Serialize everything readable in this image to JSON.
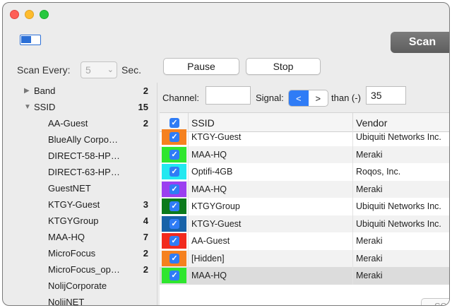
{
  "toolbar": {
    "scan_label": "Scan",
    "scan_every_label": "Scan Every:",
    "interval_value": "5",
    "sec_label": "Sec.",
    "pause_label": "Pause",
    "stop_label": "Stop"
  },
  "filters": {
    "channel_label": "Channel:",
    "channel_value": "",
    "signal_label": "Signal:",
    "signal_less": "<",
    "signal_greater": ">",
    "than_label": "than (-)",
    "threshold_value": "35"
  },
  "tree": [
    {
      "label": "Band",
      "count": "2",
      "expanded": false,
      "level": 0
    },
    {
      "label": "SSID",
      "count": "15",
      "expanded": true,
      "level": 0
    },
    {
      "label": "AA-Guest",
      "count": "2",
      "level": 1
    },
    {
      "label": "BlueAlly Corpo…",
      "count": "",
      "level": 1
    },
    {
      "label": "DIRECT-58-HP…",
      "count": "",
      "level": 1
    },
    {
      "label": "DIRECT-63-HP…",
      "count": "",
      "level": 1
    },
    {
      "label": "GuestNET",
      "count": "",
      "level": 1
    },
    {
      "label": "KTGY-Guest",
      "count": "3",
      "level": 1
    },
    {
      "label": "KTGYGroup",
      "count": "4",
      "level": 1
    },
    {
      "label": "MAA-HQ",
      "count": "7",
      "level": 1
    },
    {
      "label": "MicroFocus",
      "count": "2",
      "level": 1
    },
    {
      "label": "MicroFocus_op…",
      "count": "2",
      "level": 1
    },
    {
      "label": "NolijCorporate",
      "count": "",
      "level": 1
    },
    {
      "label": "NolijNET",
      "count": "",
      "level": 1
    }
  ],
  "table": {
    "headers": {
      "ssid": "SSID",
      "vendor": "Vendor"
    },
    "header_check": "✓",
    "rows": [
      {
        "ssid": "KTGY-Guest",
        "vendor": "Ubiquiti Networks Inc.",
        "color": "#f5811f"
      },
      {
        "ssid": "MAA-HQ",
        "vendor": "Meraki",
        "color": "#2ee62e"
      },
      {
        "ssid": "Optifi-4GB",
        "vendor": "Roqos, Inc.",
        "color": "#22e8f0"
      },
      {
        "ssid": "MAA-HQ",
        "vendor": "Meraki",
        "color": "#9b3ff0"
      },
      {
        "ssid": "KTGYGroup",
        "vendor": "Ubiquiti Networks Inc.",
        "color": "#0b7a1c"
      },
      {
        "ssid": "KTGY-Guest",
        "vendor": "Ubiquiti Networks Inc.",
        "color": "#1762a8"
      },
      {
        "ssid": "AA-Guest",
        "vendor": "Meraki",
        "color": "#f22a1e"
      },
      {
        "ssid": "[Hidden]",
        "vendor": "Meraki",
        "color": "#f5811f"
      },
      {
        "ssid": "MAA-HQ",
        "vendor": "Meraki",
        "color": "#2ee62e"
      }
    ]
  },
  "bottom_button_label": "SSI"
}
